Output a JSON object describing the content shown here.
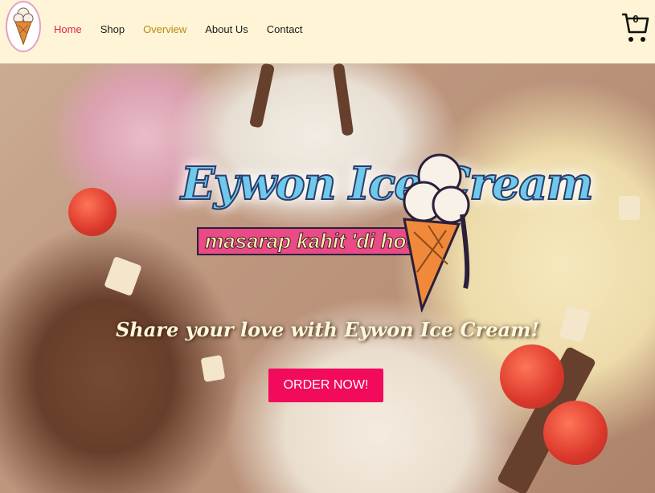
{
  "header": {
    "logo_alt": "Eywon Ice Cream logo",
    "nav": [
      {
        "label": "Home"
      },
      {
        "label": "Shop"
      },
      {
        "label": "Overview"
      },
      {
        "label": "About Us"
      },
      {
        "label": "Contact"
      }
    ],
    "cart_count": "0",
    "colors": {
      "background": "#fff4d6",
      "active": "#e0234e",
      "highlight": "#b88a12"
    }
  },
  "hero": {
    "brand_title": "Eywon Ice Cream",
    "brand_slogan": "masarap kahit 'di hot!",
    "tagline": "Share your love with Eywon Ice Cream!",
    "cta_label": "ORDER NOW!",
    "cta_color": "#f20a5c"
  },
  "icons": [
    "ice-cream-cone-logo-icon",
    "cart-icon"
  ]
}
